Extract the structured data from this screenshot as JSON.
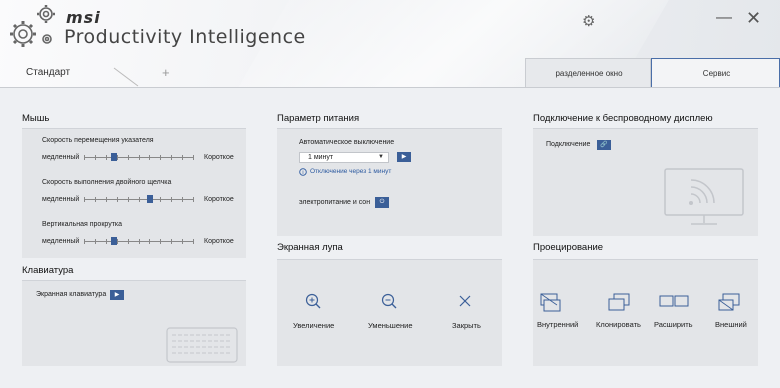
{
  "app": {
    "brand": "msi",
    "title": "Productivity Intelligence"
  },
  "tabs": {
    "standard": "Стандарт",
    "add": "+",
    "duplicate": "разделенное окно",
    "service": "Сервис"
  },
  "mouse": {
    "title": "Мышь",
    "sliders": [
      {
        "label": "Скорость перемещения указателя",
        "min_label": "медленный",
        "max_label": "Короткое",
        "value": 0.27
      },
      {
        "label": "Скорость выполнения двойного щелчка",
        "min_label": "медленный",
        "max_label": "Короткое",
        "value": 0.6
      },
      {
        "label": "Вертикальная прокрутка",
        "min_label": "медленный",
        "max_label": "Короткое",
        "value": 0.27
      }
    ]
  },
  "keyboard": {
    "title": "Клавиатура",
    "onscreen_label": "Экранная клавиатура"
  },
  "power": {
    "title": "Параметр питания",
    "auto_off_label": "Автоматическое выключение",
    "auto_off_value": "1 минут",
    "info_text": "Отключение через 1 минут",
    "sleep_label": "электропитание и сон"
  },
  "magnifier": {
    "title": "Экранная лупа",
    "buttons": [
      {
        "label": "Увеличение",
        "icon": "zoom-in-icon"
      },
      {
        "label": "Уменьшение",
        "icon": "zoom-out-icon"
      },
      {
        "label": "Закрыть",
        "icon": "close-icon"
      }
    ]
  },
  "wireless": {
    "title": "Подключение к беспроводному дисплею",
    "connect_label": "Подключение"
  },
  "projection": {
    "title": "Проецирование",
    "options": [
      {
        "label": "Внутренний",
        "icon": "pc-screen-only-icon"
      },
      {
        "label": "Клонировать",
        "icon": "duplicate-icon"
      },
      {
        "label": "Расширить",
        "icon": "extend-icon"
      },
      {
        "label": "Внешний",
        "icon": "second-screen-only-icon"
      }
    ]
  },
  "colors": {
    "accent": "#3b5f98",
    "panel": "#e3e5e8",
    "background": "#eef0f3"
  }
}
